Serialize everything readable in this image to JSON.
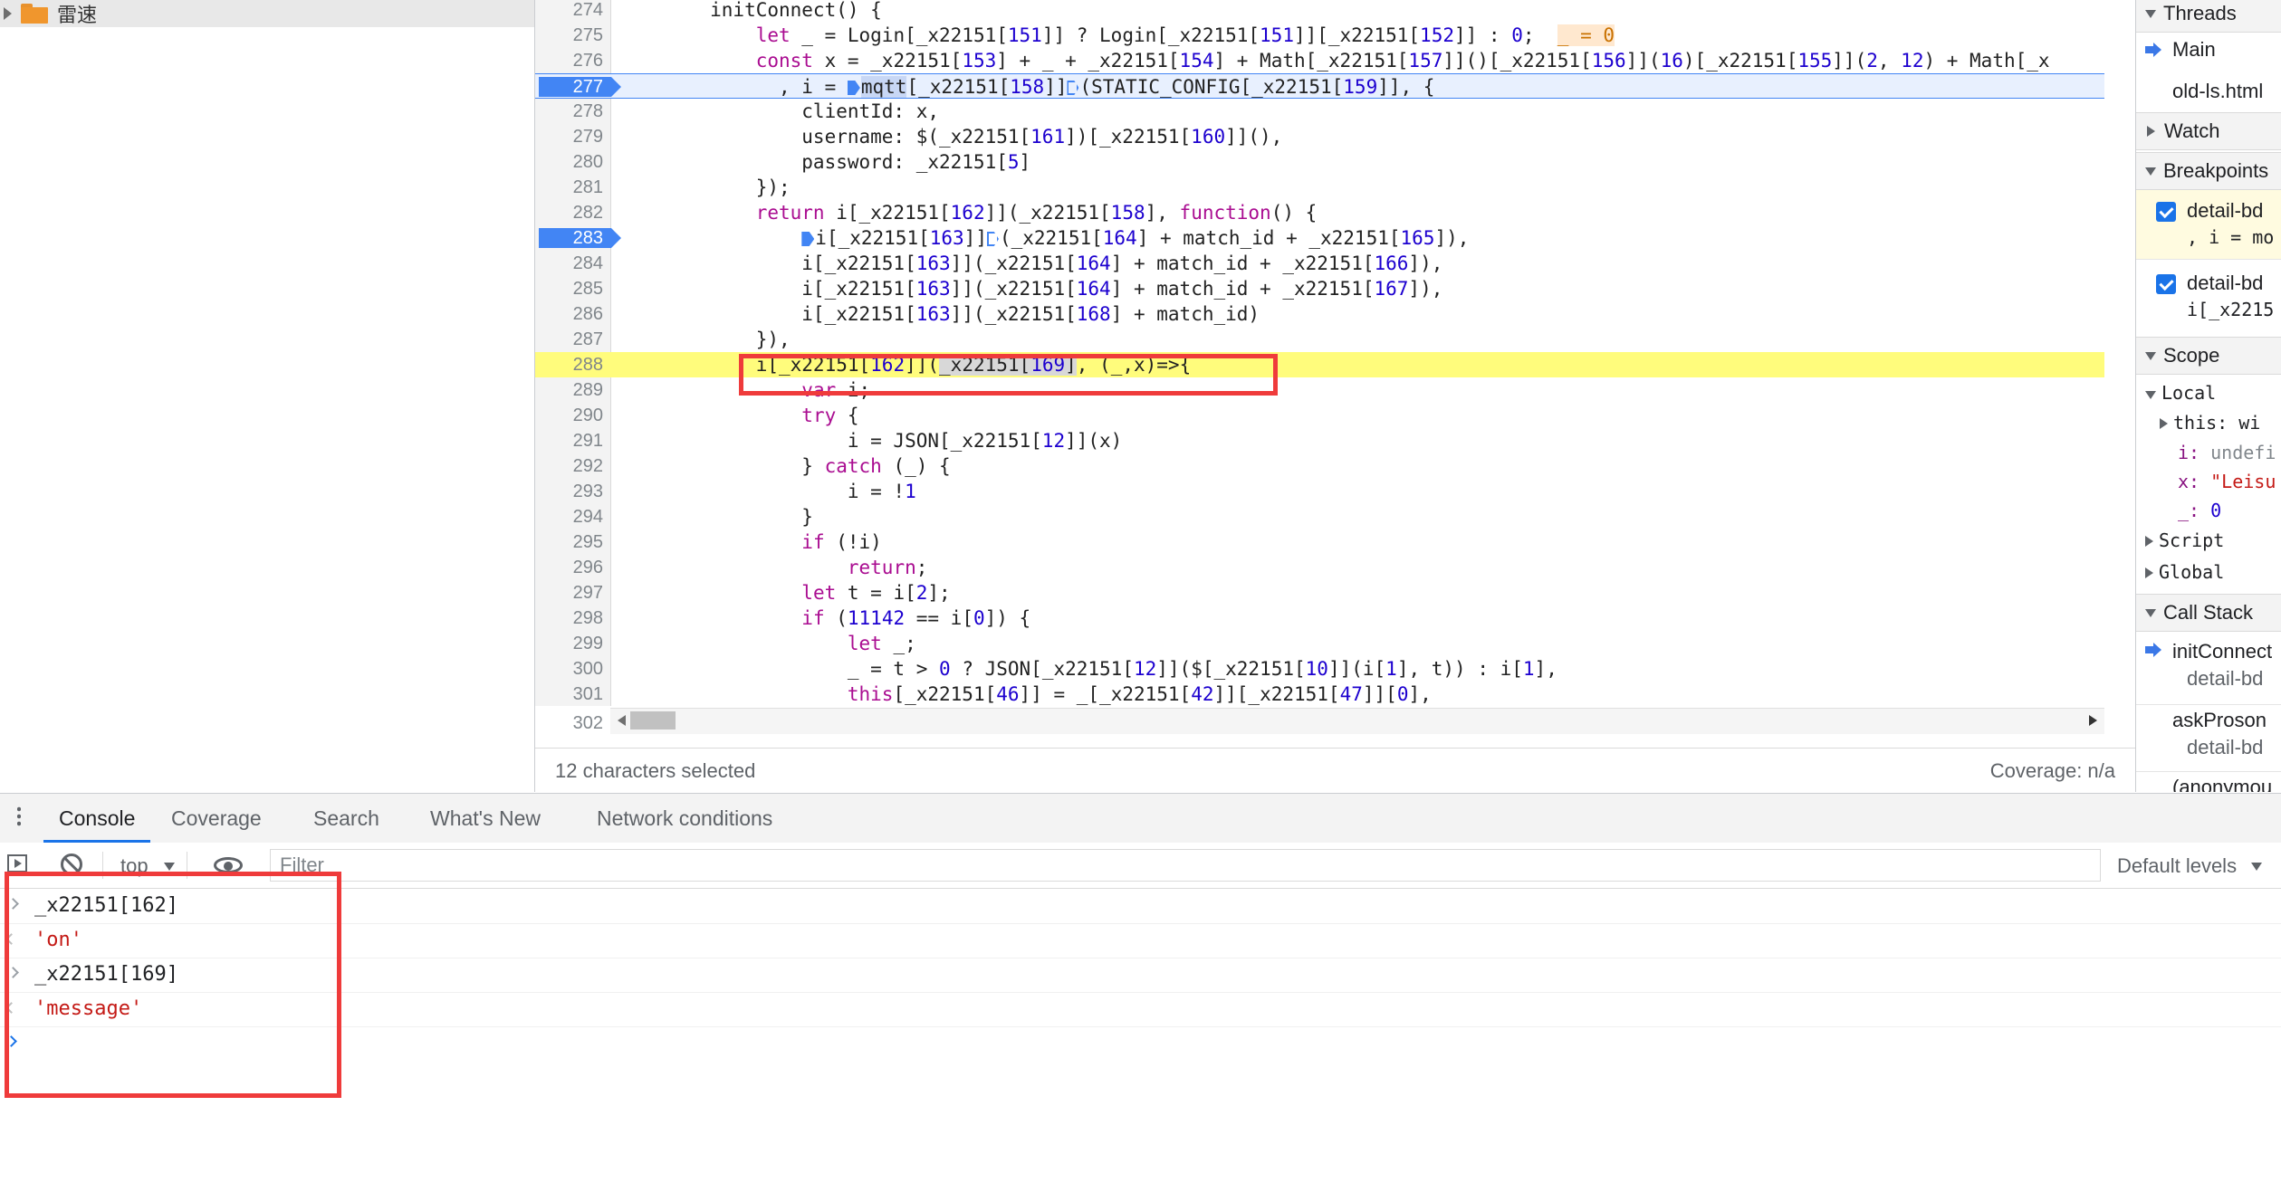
{
  "file_tree": {
    "folder_label": "雷速"
  },
  "editor": {
    "lines": [
      {
        "n": "274"
      },
      {
        "n": "275"
      },
      {
        "n": "276"
      },
      {
        "n": "277"
      },
      {
        "n": "278"
      },
      {
        "n": "279"
      },
      {
        "n": "280"
      },
      {
        "n": "281"
      },
      {
        "n": "282"
      },
      {
        "n": "283"
      },
      {
        "n": "284"
      },
      {
        "n": "285"
      },
      {
        "n": "286"
      },
      {
        "n": "287"
      },
      {
        "n": "288"
      },
      {
        "n": "289"
      },
      {
        "n": "290"
      },
      {
        "n": "291"
      },
      {
        "n": "292"
      },
      {
        "n": "293"
      },
      {
        "n": "294"
      },
      {
        "n": "295"
      },
      {
        "n": "296"
      },
      {
        "n": "297"
      },
      {
        "n": "298"
      },
      {
        "n": "299"
      },
      {
        "n": "300"
      },
      {
        "n": "301"
      },
      {
        "n": "302"
      }
    ]
  },
  "status_bar": {
    "selection": "12 characters selected",
    "coverage": "Coverage: n/a"
  },
  "sidebar": {
    "threads": "Threads",
    "thread_main": "Main",
    "thread_file": "old-ls.html",
    "watch": "Watch",
    "breakpoints": "Breakpoints",
    "bp1_file": "detail-bd",
    "bp1_code": ", i = mo",
    "bp2_file": "detail-bd",
    "bp2_code": "i[_x2215",
    "scope": "Scope",
    "local": "Local",
    "this_label": "this: wi",
    "var_i_key": "i:",
    "var_i_val": "undefi",
    "var_x_key": "x:",
    "var_x_val": "\"Leisu",
    "var_u_key": "_:",
    "var_u_val": "0",
    "script": "Script",
    "global": "Global",
    "call_stack": "Call Stack",
    "cs1_fn": "initConnect",
    "cs1_file": "detail-bd",
    "cs2_fn": "askProson",
    "cs2_file": "detail-bd",
    "cs3_fn": "(anonymou"
  },
  "drawer": {
    "tabs": [
      "Console",
      "Coverage",
      "Search",
      "What's New",
      "Network conditions"
    ],
    "context": "top",
    "filter_placeholder": "Filter",
    "levels": "Default levels"
  },
  "console": {
    "entries": [
      {
        "input": "_x22151[162]",
        "result": "'on'"
      },
      {
        "input": "_x22151[169]",
        "result": "'message'"
      }
    ]
  }
}
